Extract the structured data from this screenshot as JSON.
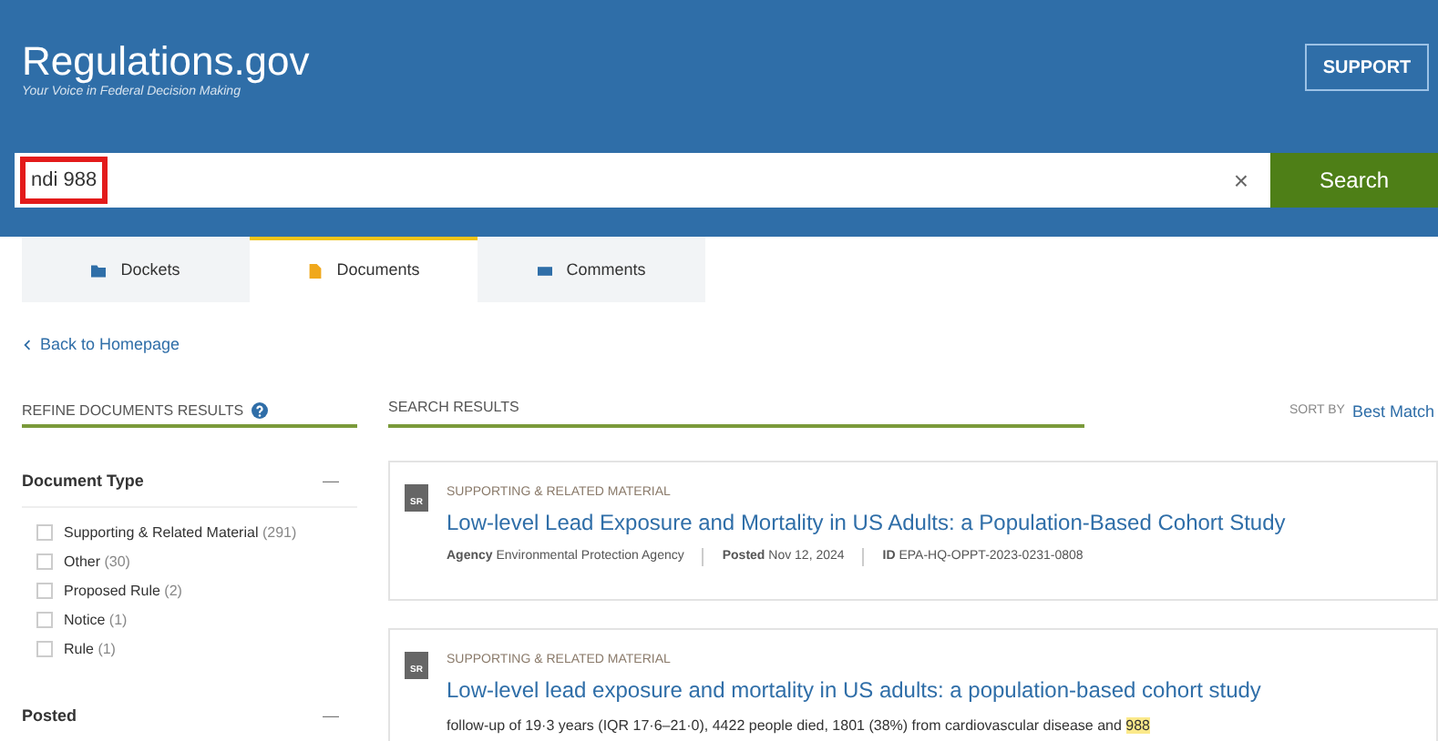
{
  "header": {
    "logo": "Regulations.gov",
    "tagline": "Your Voice in Federal Decision Making",
    "support_button": "SUPPORT"
  },
  "search": {
    "value": "ndi 988",
    "annotated": true,
    "clear": "×",
    "button": "Search"
  },
  "tabs": [
    {
      "label": "Dockets",
      "kind": "folder",
      "selected": false
    },
    {
      "label": "Documents",
      "kind": "document",
      "selected": true
    },
    {
      "label": "Comments",
      "kind": "comment",
      "selected": false
    }
  ],
  "back_link": "Back to Homepage",
  "sidebar": {
    "title": "REFINE DOCUMENTS RESULTS",
    "sections": [
      {
        "title": "Document Type",
        "toggle": "—",
        "options": [
          {
            "label": "Supporting & Related Material",
            "count": "(291)",
            "checked": false
          },
          {
            "label": "Other",
            "count": "(30)",
            "checked": false
          },
          {
            "label": "Proposed Rule",
            "count": "(2)",
            "checked": false
          },
          {
            "label": "Notice",
            "count": "(1)",
            "checked": false
          },
          {
            "label": "Rule",
            "count": "(1)",
            "checked": false
          }
        ]
      },
      {
        "title": "Posted",
        "toggle": "—"
      }
    ]
  },
  "results": {
    "title": "SEARCH RESULTS",
    "sort_label": "SORT BY",
    "sort_value": "Best Match",
    "items": [
      {
        "badge": "SR",
        "type": "SUPPORTING & RELATED MATERIAL",
        "title": "Low-level Lead Exposure and Mortality in US Adults: a Population-Based Cohort Study",
        "meta": [
          {
            "label": "Agency",
            "value": "Environmental Protection Agency"
          },
          {
            "label": "Posted",
            "value": "Nov 12, 2024"
          },
          {
            "label": "ID",
            "value": "EPA-HQ-OPPT-2023-0231-0808"
          }
        ]
      },
      {
        "badge": "SR",
        "type": "SUPPORTING & RELATED MATERIAL",
        "title": "Low-level lead exposure and mortality in US adults: a population-based cohort study",
        "snippet": [
          {
            "text": "follow-up of 19·3 years (IQR 17·6–21·0), 4422 people died, 1801 (38%) from cardiovascular disease and ",
            "highlight": false
          },
          {
            "text": "988",
            "highlight": true
          }
        ]
      }
    ]
  }
}
